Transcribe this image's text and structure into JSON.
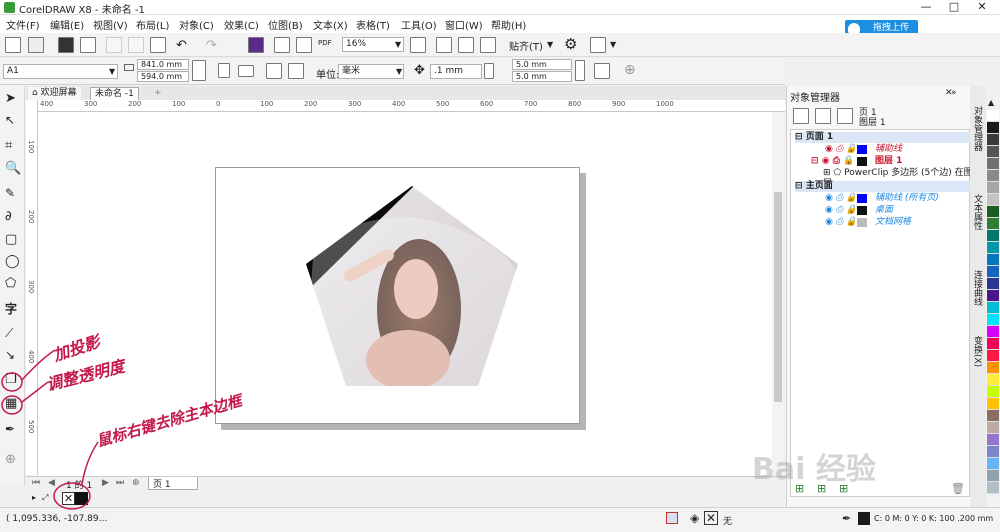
{
  "app": {
    "title": "CorelDRAW X8 - 未命名 -1"
  },
  "menu": [
    "文件(F)",
    "编辑(E)",
    "视图(V)",
    "布局(L)",
    "对象(C)",
    "效果(C)",
    "位图(B)",
    "文本(X)",
    "表格(T)",
    "工具(O)",
    "窗口(W)",
    "帮助(H)"
  ],
  "upload_label": "拖拽上传",
  "toolbar1": {
    "zoom": "16%",
    "snap_label": "贴齐(T)",
    "pdf_label": "PDF"
  },
  "toolbar2": {
    "paper": "A1",
    "width": "841.0 mm",
    "height": "594.0 mm",
    "unit_label": "单位:",
    "unit": "毫米",
    "nudge": ".1 mm",
    "dup_x": "5.0 mm",
    "dup_y": "5.0 mm"
  },
  "doc_tabs": {
    "welcome": "欢迎屏幕",
    "doc": "未命名 -1"
  },
  "ruler": {
    "h_labels": [
      "400",
      "300",
      "200",
      "100",
      "0",
      "100",
      "200",
      "300",
      "400",
      "500",
      "600",
      "700",
      "800",
      "900",
      "1000"
    ],
    "v_labels": [
      "100",
      "200",
      "300",
      "400",
      "500"
    ]
  },
  "page_tabs": {
    "page_counter": "1 的 1",
    "page_name": "页 1"
  },
  "status": {
    "coords": "( 1,095.336, -107.89...",
    "fill_label": "无",
    "outline": "C: 0 M: 0 Y: 0 K: 100  .200 mm"
  },
  "object_manager": {
    "title": "对象管理器",
    "current_page": "页 1",
    "current_layer": "图层 1",
    "rows": [
      {
        "label": "页面 1",
        "type": "page"
      },
      {
        "label": "辅助线",
        "type": "layer",
        "color": "#0000ff"
      },
      {
        "label": "图层 1",
        "type": "layer",
        "color": "#111111"
      },
      {
        "label": "PowerClip 多边形 (5个边) 在图层...",
        "type": "object"
      },
      {
        "label": "主页面",
        "type": "page"
      },
      {
        "label": "辅助线 (所有页)",
        "type": "layer",
        "color": "#0000ff"
      },
      {
        "label": "桌面",
        "type": "layer",
        "color": "#111111"
      },
      {
        "label": "文档网格",
        "type": "layer",
        "color": "#bbbbbb"
      }
    ]
  },
  "vertical_tabs": [
    "对象管理器",
    "文本属性",
    "连接曲线",
    "变换(X)"
  ],
  "palette_colors": [
    "#ffffff",
    "#1a1a1a",
    "#3a3a3a",
    "#555555",
    "#707070",
    "#8a8a8a",
    "#a6a6a6",
    "#c3c3c3",
    "#1b5e20",
    "#2e7d32",
    "#00796b",
    "#0097a7",
    "#0277bd",
    "#1565c0",
    "#283593",
    "#4a148c",
    "#00bcd4",
    "#00e5ff",
    "#d500f9",
    "#f50057",
    "#ff1744",
    "#ff9100",
    "#ffeb3b",
    "#c6ff00",
    "#ffc107",
    "#8d6e63",
    "#bcaaa4",
    "#9575cd",
    "#7986cb",
    "#64b5f6",
    "#90a4ae",
    "#b0bec5"
  ],
  "annotations": {
    "shadow": "加投影",
    "transparency": "调整透明度",
    "outline": "鼠标右键去除主本边框"
  },
  "watermark": "Bai 经验"
}
